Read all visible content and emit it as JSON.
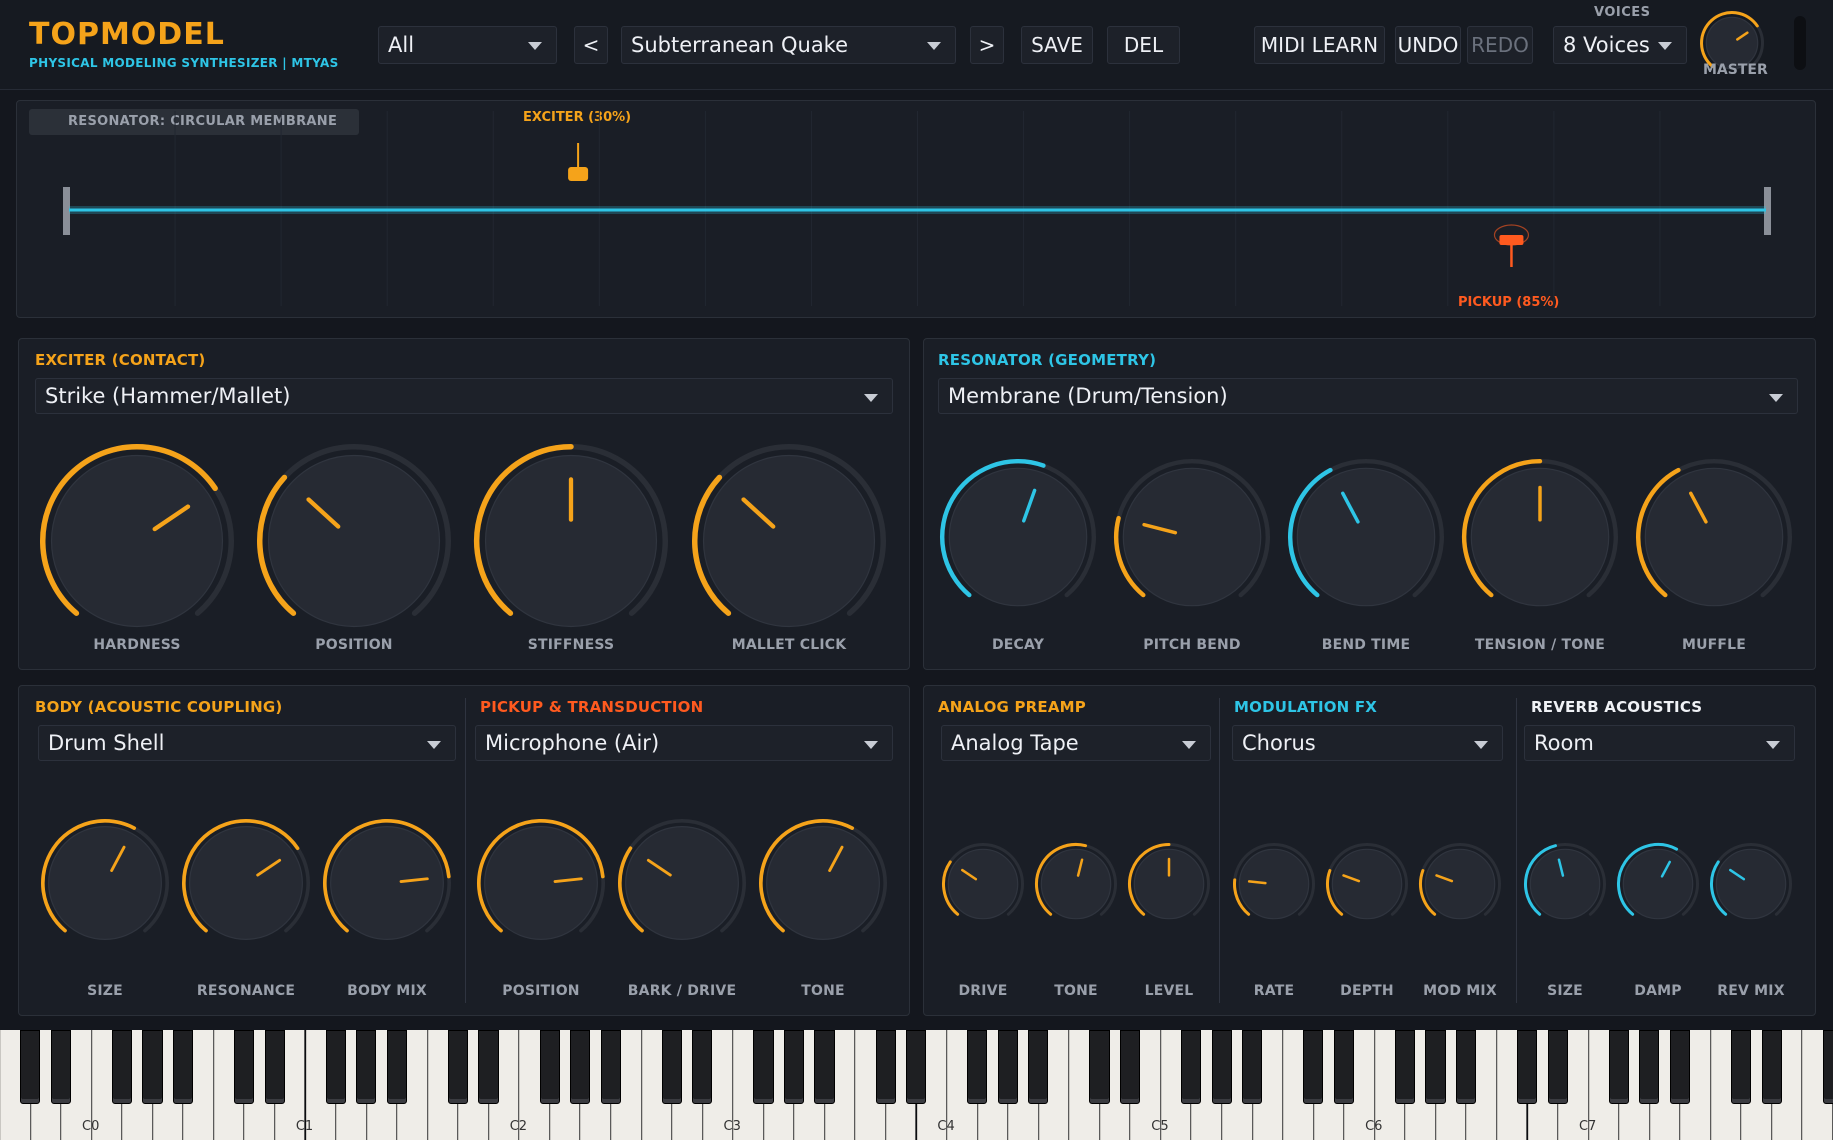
{
  "colors": {
    "orange": "#f5a31a",
    "red": "#ff5a1f",
    "cyan": "#2ec5e6",
    "track": "#2a2e36"
  },
  "header": {
    "title": "TOPMODEL",
    "subtitle": "PHYSICAL MODELING SYNTHESIZER | MTYAS",
    "category": "All",
    "prev_label": "<",
    "next_label": ">",
    "preset": "Subterranean Quake",
    "save_label": "SAVE",
    "del_label": "DEL",
    "midi_label": "MIDI LEARN",
    "undo_label": "UNDO",
    "redo_label": "REDO",
    "voices_label": "VOICES",
    "voices_value": "8 Voices",
    "master_label": "MASTER",
    "master_value": 0.7
  },
  "strip": {
    "tag": "RESONATOR: CIRCULAR MEMBRANE",
    "exciter_label": "EXCITER (30%)",
    "exciter_pos": 0.3,
    "pickup_label": "PICKUP (85%)",
    "pickup_pos": 0.85
  },
  "exciter": {
    "title": "EXCITER (CONTACT)",
    "mode": "Strike (Hammer/Mallet)",
    "knobs": [
      {
        "label": "HARDNESS",
        "value": 0.7
      },
      {
        "label": "POSITION",
        "value": 0.33
      },
      {
        "label": "STIFFNESS",
        "value": 0.5
      },
      {
        "label": "MALLET CLICK",
        "value": 0.33
      }
    ]
  },
  "resonator": {
    "title": "RESONATOR (GEOMETRY)",
    "mode": "Membrane (Drum/Tension)",
    "knobs": [
      {
        "label": "DECAY",
        "value": 0.57
      },
      {
        "label": "PITCH BEND",
        "value": 0.23
      },
      {
        "label": "BEND TIME",
        "value": 0.4
      },
      {
        "label": "TENSION / TONE",
        "value": 0.5
      },
      {
        "label": "MUFFLE",
        "value": 0.4
      }
    ]
  },
  "body": {
    "title": "BODY (ACOUSTIC COUPLING)",
    "mode": "Drum Shell",
    "knobs": [
      {
        "label": "SIZE",
        "value": 0.6
      },
      {
        "label": "RESONANCE",
        "value": 0.7
      },
      {
        "label": "BODY MIX",
        "value": 0.8
      }
    ]
  },
  "pickup": {
    "title": "PICKUP & TRANSDUCTION",
    "mode": "Microphone (Air)",
    "knobs": [
      {
        "label": "POSITION",
        "value": 0.8
      },
      {
        "label": "BARK / DRIVE",
        "value": 0.3
      },
      {
        "label": "TONE",
        "value": 0.6
      }
    ]
  },
  "preamp": {
    "title": "ANALOG PREAMP",
    "mode": "Analog Tape",
    "knobs": [
      {
        "label": "DRIVE",
        "value": 0.3
      },
      {
        "label": "TONE",
        "value": 0.55
      },
      {
        "label": "LEVEL",
        "value": 0.5
      }
    ]
  },
  "modfx": {
    "title": "MODULATION FX",
    "mode": "Chorus",
    "knobs": [
      {
        "label": "RATE",
        "value": 0.2
      },
      {
        "label": "DEPTH",
        "value": 0.25
      },
      {
        "label": "MOD MIX",
        "value": 0.25
      }
    ]
  },
  "reverb": {
    "title": "REVERB ACOUSTICS",
    "mode": "Room",
    "knobs": [
      {
        "label": "SIZE",
        "value": 0.45
      },
      {
        "label": "DAMP",
        "value": 0.6
      },
      {
        "label": "REV MIX",
        "value": 0.3
      }
    ]
  },
  "keyboard": {
    "octave_labels": [
      "C0",
      "C1",
      "C2",
      "C3",
      "C4",
      "C5",
      "C6",
      "C7"
    ]
  }
}
